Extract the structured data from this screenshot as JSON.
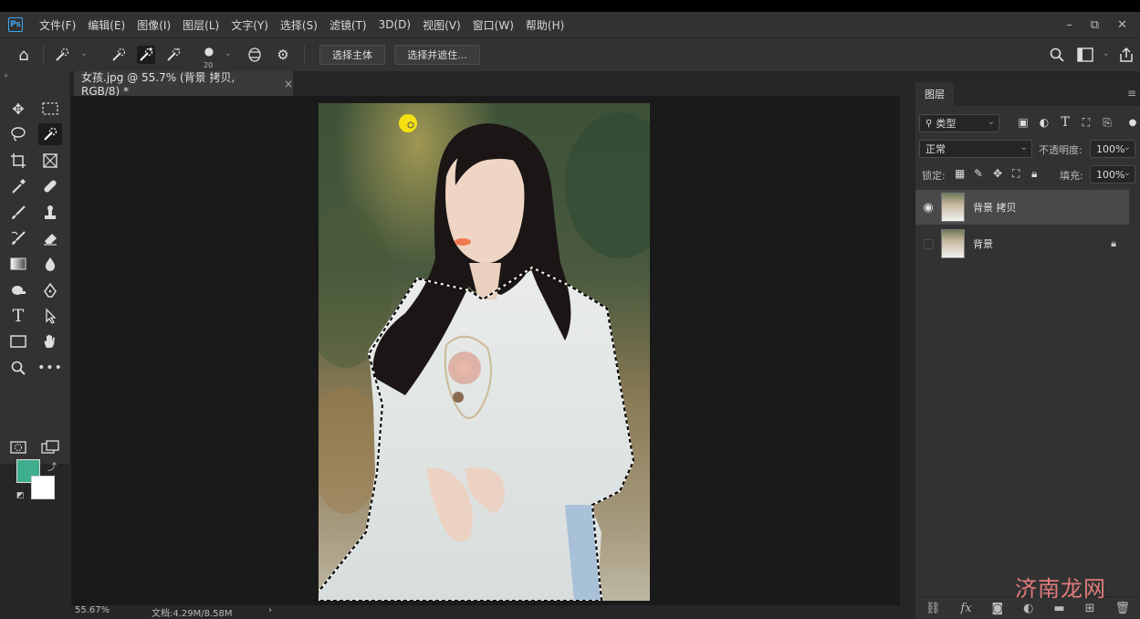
{
  "app": {
    "logo": "Ps"
  },
  "menu": [
    "文件(F)",
    "编辑(E)",
    "图像(I)",
    "图层(L)",
    "文字(Y)",
    "选择(S)",
    "滤镜(T)",
    "3D(D)",
    "视图(V)",
    "窗口(W)",
    "帮助(H)"
  ],
  "window_controls": {
    "minimize": "–",
    "restore": "⧉",
    "close": "✕"
  },
  "options_bar": {
    "brush_size": "20",
    "select_subject_label": "选择主体",
    "select_and_mask_label": "选择并遮住..."
  },
  "document_tab": {
    "title": "女孩.jpg @ 55.7% (背景 拷贝, RGB/8) *",
    "close": "×"
  },
  "status_bar": {
    "zoom": "55.67%",
    "doc_info": "文档:4.29M/8.58M",
    "arrow": "›"
  },
  "colors": {
    "foreground": "#3fae8e",
    "background": "#ffffff"
  },
  "layers_panel": {
    "tab_label": "图层",
    "filter_kind": "类型",
    "blend_mode": "正常",
    "opacity_label": "不透明度:",
    "opacity_value": "100%",
    "lock_label": "锁定:",
    "fill_label": "填充:",
    "fill_value": "100%",
    "layers": [
      {
        "name": "背景 拷贝",
        "visible": true,
        "selected": true,
        "locked": false
      },
      {
        "name": "背景",
        "visible": false,
        "selected": false,
        "locked": true
      }
    ]
  },
  "watermark": "济南龙网"
}
